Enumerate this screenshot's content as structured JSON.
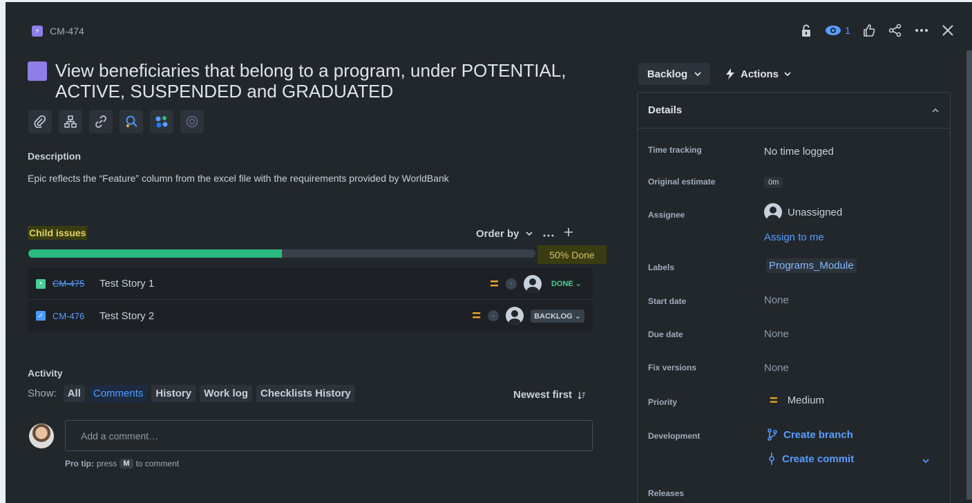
{
  "header": {
    "issue_key": "CM-474",
    "watch_count": "1",
    "title": "View beneficiaries that belong to a program, under POTENTIAL, ACTIVE, SUSPENDED and GRADUATED"
  },
  "description": {
    "label": "Description",
    "text": "Epic reflects the “Feature” column from the excel file with the requirements provided by WorldBank"
  },
  "child_issues": {
    "label": "Child issues",
    "order_by": "Order by",
    "progress_fraction": 0.5,
    "progress_label": "50% Done",
    "items": [
      {
        "key": "CM-475",
        "summary": "Test Story 1",
        "dash": "-",
        "status": "DONE"
      },
      {
        "key": "CM-476",
        "summary": "Test Story 2",
        "dash": "-",
        "status": "BACKLOG"
      }
    ]
  },
  "activity": {
    "label": "Activity",
    "show_label": "Show:",
    "filters": [
      "All",
      "Comments",
      "History",
      "Work log",
      "Checklists History"
    ],
    "sort": "Newest first",
    "comment_placeholder": "Add a comment…",
    "protip_bold": "Pro tip:",
    "protip_press": "press",
    "protip_key": "M",
    "protip_rest": "to comment"
  },
  "panel": {
    "status": "Backlog",
    "actions": "Actions",
    "details_title": "Details",
    "time_tracking_label": "Time tracking",
    "time_tracking_value": "No time logged",
    "original_estimate_label": "Original estimate",
    "original_estimate_value": "0m",
    "assignee_label": "Assignee",
    "assignee_value": "Unassigned",
    "assign_to_me": "Assign to me",
    "labels_label": "Labels",
    "labels_value": "Programs_Module",
    "start_date_label": "Start date",
    "start_date_value": "None",
    "due_date_label": "Due date",
    "due_date_value": "None",
    "fix_versions_label": "Fix versions",
    "fix_versions_value": "None",
    "priority_label": "Priority",
    "priority_value": "Medium",
    "development_label": "Development",
    "create_branch": "Create branch",
    "create_commit": "Create commit",
    "releases_label": "Releases"
  },
  "colors": {
    "background": "#22272b",
    "accent": "#579dff",
    "epic": "#8f7ee7",
    "progress": "#2abb7f",
    "priority_medium": "#f5a524"
  }
}
